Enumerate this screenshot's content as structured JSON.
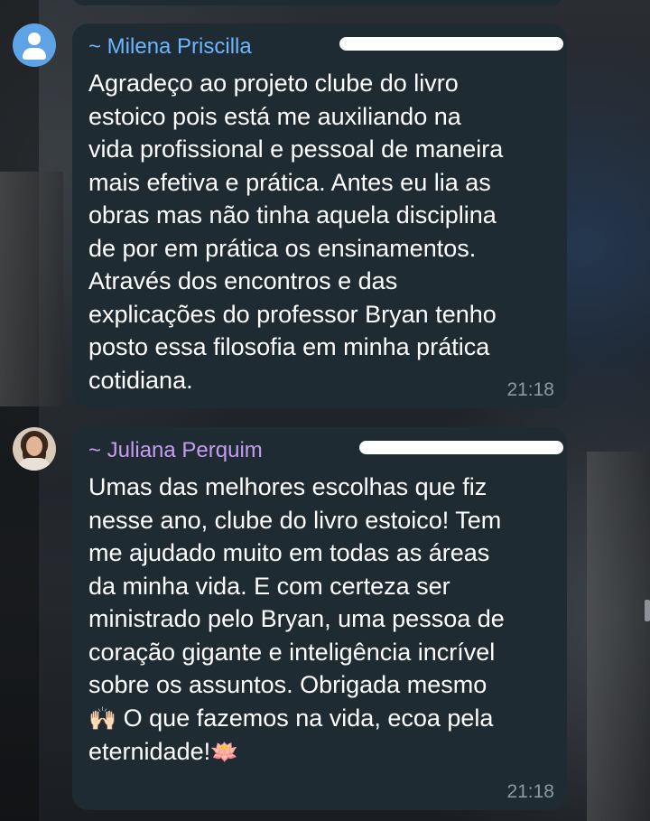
{
  "messages": [
    {
      "sender": "~ Milena Priscilla",
      "text": "Agradeço ao projeto clube do livro\nestoico pois está me auxiliando na\nvida profissional e pessoal de maneira\nmais efetiva e prática. Antes eu lia as\nobras mas não tinha aquela disciplina\nde por em prática os ensinamentos.\nAtravés dos encontros e das\nexplicações do professor Bryan tenho\nposto essa filosofia em minha prática\ncotidiana.",
      "time": "21:18"
    },
    {
      "sender": "~ Juliana Perquim",
      "text": "Umas das melhores escolhas que fiz\nnesse ano, clube do livro estoico! Tem\nme ajudado muito em todas as áreas\nda minha vida. E com certeza ser\nministrado pelo Bryan, uma pessoa de\ncoração gigante e inteligência incrível\nsobre os assuntos. Obrigada mesmo",
      "text_line8": "O que fazemos na vida, ecoa pela",
      "text_line9": "eternidade!",
      "emoji_hands": "🙌🏻",
      "emoji_lotus": "🪷",
      "time": "21:18"
    }
  ],
  "colors": {
    "bubble": "#1f2b33",
    "sender_milena": "#6cb6ff",
    "sender_juliana": "#c79cf0",
    "timestamp": "#8a9aa5"
  },
  "icons": [
    "default-avatar-icon",
    "user-photo-avatar"
  ]
}
